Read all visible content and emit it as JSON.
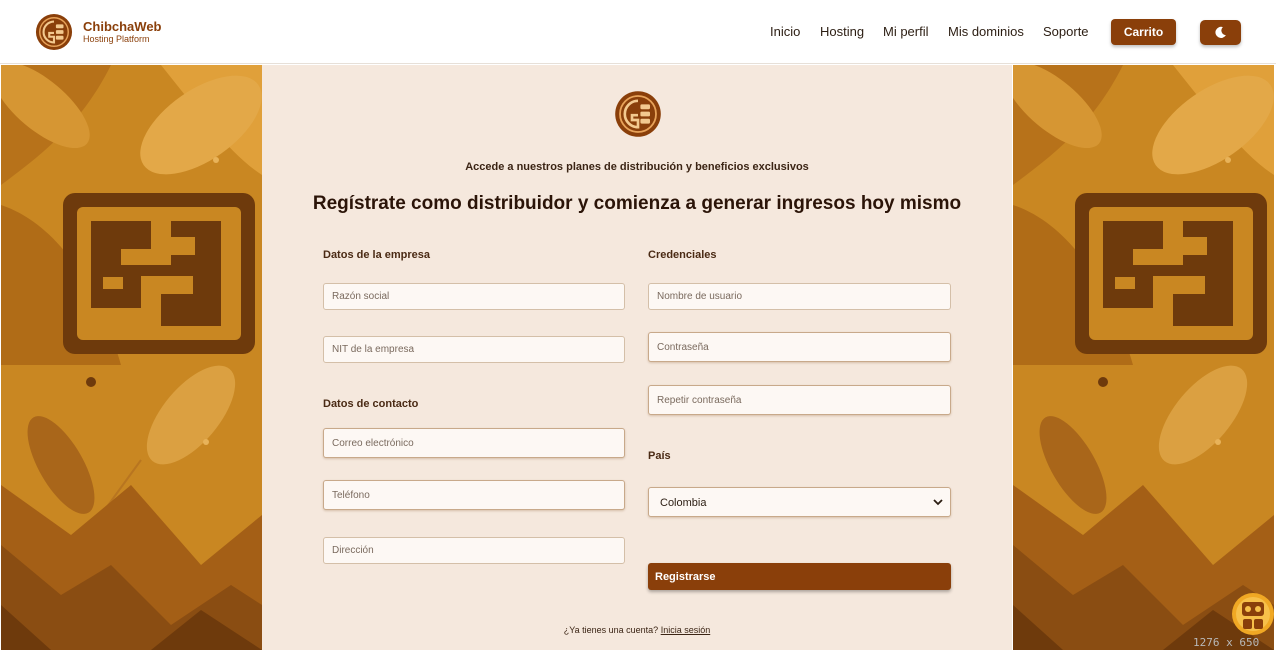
{
  "brand": {
    "name": "ChibchaWeb",
    "tagline": "Hosting Platform"
  },
  "nav": {
    "items": [
      "Inicio",
      "Hosting",
      "Mi perfil",
      "Mis dominios",
      "Soporte"
    ],
    "cart_label": "Carrito",
    "theme_icon": "moon-icon"
  },
  "form": {
    "subtitle": "Accede a nuestros planes de distribución y beneficios exclusivos",
    "title": "Regístrate como distribuidor y comienza a generar ingresos hoy mismo",
    "company_section": "Datos de la empresa",
    "contact_section": "Datos de contacto",
    "credentials_section": "Credenciales",
    "country_section": "País",
    "placeholders": {
      "razon_social": "Razón social",
      "nit": "NIT de la empresa",
      "email": "Correo electrónico",
      "phone": "Teléfono",
      "address": "Dirección",
      "username": "Nombre de usuario",
      "password": "Contraseña",
      "repeat_password": "Repetir contraseña"
    },
    "country_value": "Colombia",
    "submit_label": "Registrarse",
    "login_prompt": "¿Ya tienes una cuenta?",
    "login_link": "Inicia sesión"
  },
  "overlay": {
    "dims": "1276 x 650"
  },
  "colors": {
    "brand": "#8a3f0a",
    "panel_bg": "#f5e8dd",
    "pattern_gold": "#c7831e",
    "pattern_dark": "#6e3a0c"
  }
}
